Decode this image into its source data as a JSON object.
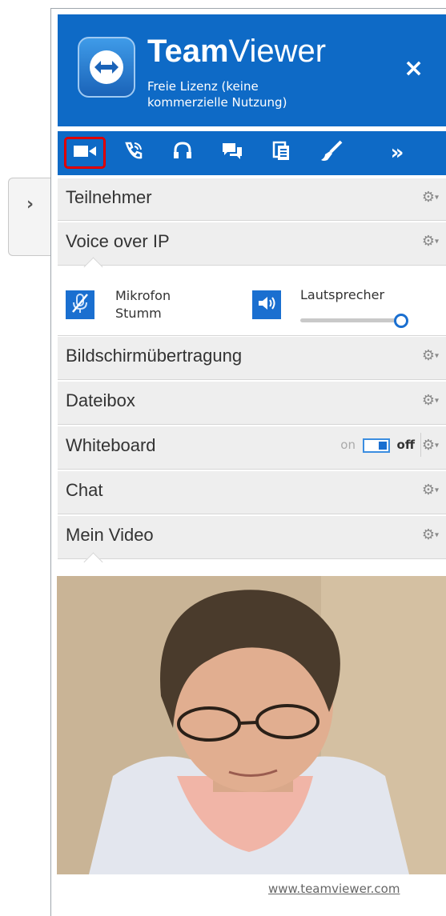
{
  "side_tab": {
    "icon": "chevron-right-icon"
  },
  "header": {
    "brand_bold": "Team",
    "brand_light": "Viewer",
    "subtitle": "Freie Lizenz (keine kommerzielle Nutzung)",
    "close_label": "×",
    "color": "#0e6ac6"
  },
  "toolbar": {
    "buttons": [
      {
        "icon": "video-camera-icon",
        "selected": true
      },
      {
        "icon": "phone-call-icon"
      },
      {
        "icon": "headset-icon"
      },
      {
        "icon": "chat-bubbles-icon"
      },
      {
        "icon": "file-box-icon"
      },
      {
        "icon": "brush-icon"
      },
      {
        "icon": "more-chevrons-icon",
        "label": "»"
      }
    ],
    "highlight_color": "#e00000"
  },
  "sections": {
    "teilnehmer": "Teilnehmer",
    "voip": "Voice over IP",
    "bildschirm": "Bildschirmübertragung",
    "dateibox": "Dateibox",
    "whiteboard": "Whiteboard",
    "chat": "Chat",
    "video": "Mein Video"
  },
  "voip": {
    "mic_label_1": "Mikrofon",
    "mic_label_2": "Stumm",
    "speaker_label": "Lautsprecher",
    "speaker_volume": 1.0
  },
  "whiteboard_toggle": {
    "on": "on",
    "off": "off"
  },
  "footer": {
    "link": "www.teamviewer.com"
  }
}
